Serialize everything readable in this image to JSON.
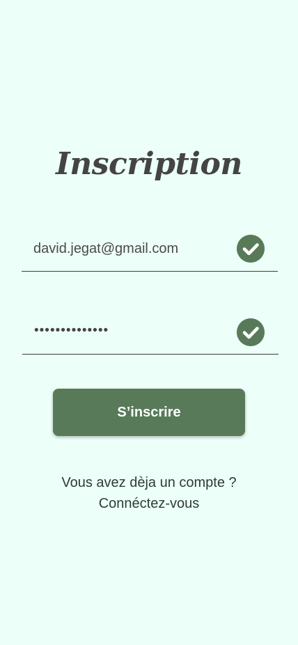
{
  "page": {
    "title": "Inscription",
    "background_color": "#ecfff8",
    "accent_color": "#587a59"
  },
  "form": {
    "email": {
      "value": "david.jegat@gmail.com",
      "status_icon": "check-circle-icon"
    },
    "password": {
      "value": "••••••••••••••",
      "status_icon": "check-circle-icon"
    },
    "submit_label": "S’inscrire"
  },
  "footer": {
    "prompt": "Vous avez dèja un compte ?",
    "link": "Connéctez-vous"
  }
}
